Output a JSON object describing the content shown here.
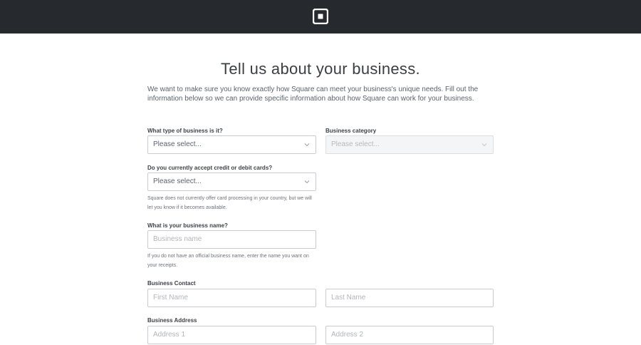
{
  "header": {
    "logo_icon": "square-logo-icon"
  },
  "page": {
    "title": "Tell us about your business.",
    "intro": "We want to make sure you know exactly how Square can meet your business's unique needs. Fill out the information below so we can provide specific information about how Square can work for your business."
  },
  "form": {
    "business_type": {
      "label": "What type of business is it?",
      "value": "Please select..."
    },
    "business_category": {
      "label": "Business category",
      "value": "Please select..."
    },
    "card_payments": {
      "label": "Do you currently accept credit or debit cards?",
      "value": "Please select...",
      "help": "Square does not currently offer card processing in your country, but we will let you know if it becomes available."
    },
    "business_name": {
      "label": "What is your business name?",
      "placeholder": "Business name",
      "help": "If you do not have an official business name, enter the name you want on your receipts."
    },
    "business_contact": {
      "label": "Business Contact",
      "first_name_placeholder": "First Name",
      "last_name_placeholder": "Last Name"
    },
    "business_address": {
      "label": "Business Address",
      "address1_placeholder": "Address 1",
      "address2_placeholder": "Address 2"
    }
  }
}
